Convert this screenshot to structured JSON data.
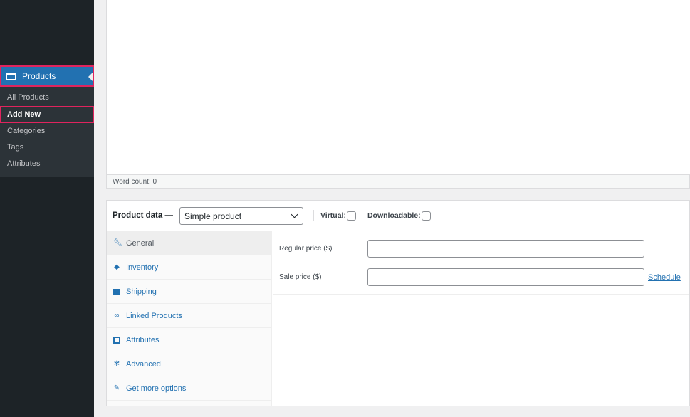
{
  "sidebar": {
    "products": "Products",
    "items": [
      "All Products",
      "Add New",
      "Categories",
      "Tags",
      "Attributes"
    ]
  },
  "editor": {
    "word_count": "Word count: 0"
  },
  "product_data": {
    "title": "Product data —",
    "type": "Simple product",
    "virtual": "Virtual:",
    "downloadable": "Downloadable:",
    "tabs": [
      {
        "label": "General",
        "icon": "wrench-icon"
      },
      {
        "label": "Inventory",
        "icon": "tag-icon"
      },
      {
        "label": "Shipping",
        "icon": "truck-icon"
      },
      {
        "label": "Linked Products",
        "icon": "link-icon"
      },
      {
        "label": "Attributes",
        "icon": "list-icon"
      },
      {
        "label": "Advanced",
        "icon": "gear-icon"
      },
      {
        "label": "Get more options",
        "icon": "plugin-icon"
      }
    ],
    "regular_price": "Regular price ($)",
    "sale_price": "Sale price ($)",
    "schedule": "Schedule"
  },
  "colors": {
    "accent": "#2271b1",
    "highlight": "#e0245e"
  }
}
